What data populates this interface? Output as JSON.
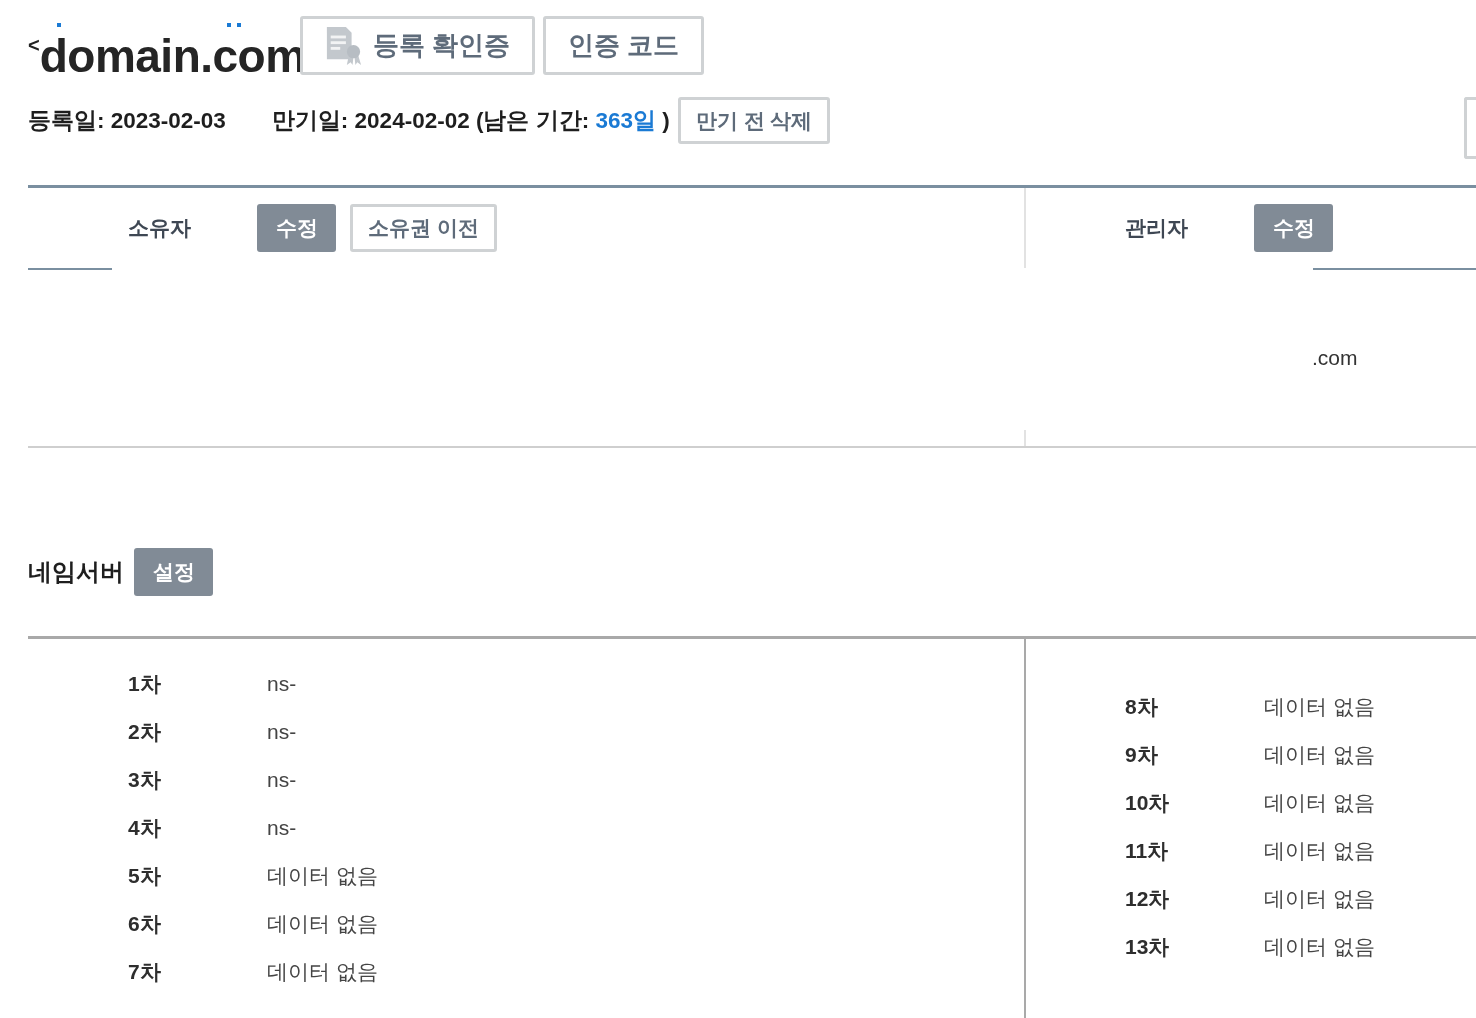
{
  "header": {
    "back_mark": "<",
    "domain": "domain.com",
    "buttons": [
      {
        "label": "등록 확인증",
        "icon": true
      },
      {
        "label": "인증 코드",
        "icon": false
      }
    ]
  },
  "dates": {
    "registered": "등록일: 2023-02-03",
    "expiry_before": "만기일: 2024-02-02 (남은 기간:",
    "remaining": "363일",
    "expiry_after": ")",
    "delete_button": "만기 전 삭제"
  },
  "contacts": [
    {
      "label": "소유자",
      "buttons": [
        {
          "label": "수정",
          "kind": "filled"
        },
        {
          "label": "소유권 이전",
          "kind": "outline"
        }
      ]
    },
    {
      "label": "관리자",
      "buttons": [
        {
          "label": "수정",
          "kind": "filled"
        }
      ],
      "value": ".com"
    }
  ],
  "nameservers": {
    "title": "네임서버",
    "button": "설정",
    "columns": [
      [
        {
          "label": "1차",
          "value": "ns-"
        },
        {
          "label": "2차",
          "value": "ns-"
        },
        {
          "label": "3차",
          "value": "ns-"
        },
        {
          "label": "4차",
          "value": "ns-"
        },
        {
          "label": "5차",
          "value": "데이터 없음"
        },
        {
          "label": "6차",
          "value": "데이터 없음"
        },
        {
          "label": "7차",
          "value": "데이터 없음"
        }
      ],
      [
        {
          "label": "8차",
          "value": "데이터 없음"
        },
        {
          "label": "9차",
          "value": "데이터 없음"
        },
        {
          "label": "10차",
          "value": "데이터 없음"
        },
        {
          "label": "11차",
          "value": "데이터 없음"
        },
        {
          "label": "12차",
          "value": "데이터 없음"
        },
        {
          "label": "13차",
          "value": "데이터 없음"
        }
      ]
    ]
  }
}
